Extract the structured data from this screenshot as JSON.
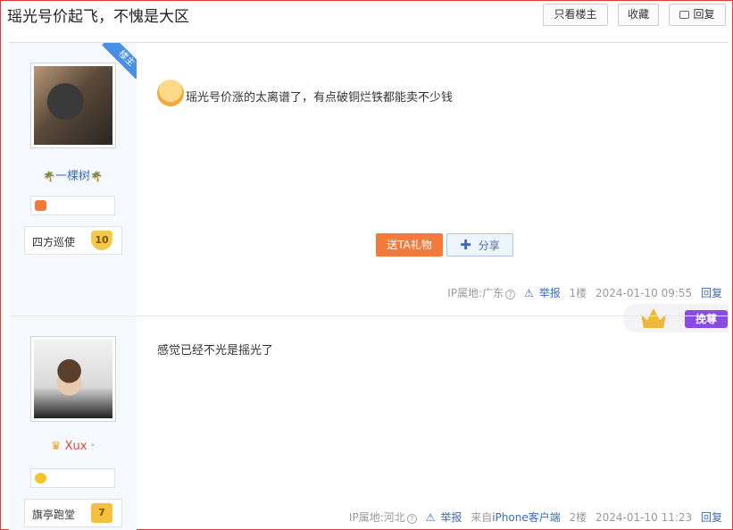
{
  "header": {
    "title": "瑶光号价起飞，不愧是大区",
    "only_owner": "只看楼主",
    "favorite": "收藏",
    "reply": "回复"
  },
  "posts": [
    {
      "owner_tag": "楼主",
      "username": "一棵树",
      "level_name": "四方巡使",
      "level_num": "10",
      "content": "瑶光号价涨的太离谱了，有点破铜烂铁都能卖不少钱",
      "gift_button": "送TA礼物",
      "share_button": "分享",
      "ip": "IP属地:广东",
      "report": "举报",
      "floor": "1楼",
      "time": "2024-01-10 09:55",
      "reply": "回复"
    },
    {
      "username": "Xux",
      "level_name": "旗亭跑堂",
      "level_num": "7",
      "content": "感觉已经不光是摇光了",
      "ip": "IP属地:河北",
      "report": "举报",
      "from_prefix": "来自",
      "client": "iPhone客户端",
      "floor": "2楼",
      "time": "2024-01-10 11:23",
      "reply": "回复",
      "vip_tag": "挽尊"
    }
  ],
  "colors": {
    "accent_blue": "#3d6bb8",
    "gift_orange": "#f47a3b",
    "frame_red": "#e03a3a",
    "vip_purple": "#8a4be0"
  }
}
